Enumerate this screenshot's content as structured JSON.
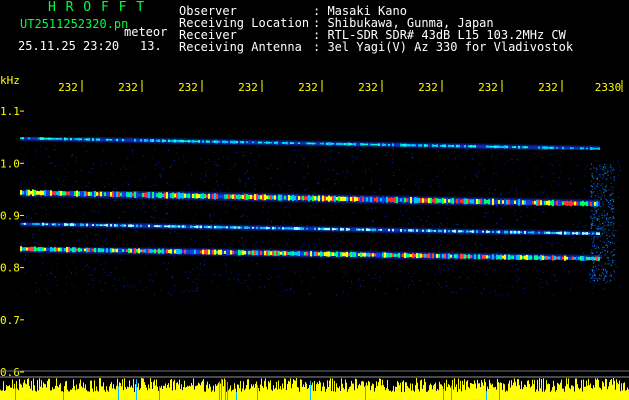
{
  "header": {
    "station": "H R O F F T",
    "filename": "UT2511252320.pn",
    "filename_suffix": "meteor",
    "datetime": "25.11.25 23:20",
    "count": "13.",
    "fields": [
      {
        "label": "Observer",
        "value": ": Masaki Kano"
      },
      {
        "label": "Receiving Location",
        "value": ": Shibukawa, Gunma, Japan"
      },
      {
        "label": "Receiver",
        "value": ": RTL-SDR SDR# 43dB L15 103.2MHz CW"
      },
      {
        "label": "Receiving Antenna",
        "value": ": 3el Yagi(V) Az 330 for Vladivostok"
      }
    ]
  },
  "axis": {
    "unit": "kHz",
    "time_labels": [
      "232",
      "232",
      "232",
      "232",
      "232",
      "232",
      "232",
      "232",
      "232",
      "2330"
    ],
    "freq_labels": [
      "1.1",
      "1.0",
      "0.9",
      "0.8",
      "0.7",
      "0.6"
    ]
  },
  "colors": {
    "background": "#000000",
    "text_header": "#00ff40",
    "text_axis": "#ffff00",
    "line_low": "#1020c0",
    "line_mid": "#00c0ff",
    "line_high": "#ff3030"
  },
  "chart_data": {
    "type": "heatmap",
    "xlabel": "",
    "ylabel": "kHz",
    "ylim": [
      0.6,
      1.15
    ],
    "traces": [
      {
        "freq_start": 1.048,
        "freq_end": 1.028
      },
      {
        "freq_start": 0.944,
        "freq_end": 0.922
      },
      {
        "freq_start": 0.884,
        "freq_end": 0.865
      },
      {
        "freq_start": 0.836,
        "freq_end": 0.817
      }
    ]
  }
}
